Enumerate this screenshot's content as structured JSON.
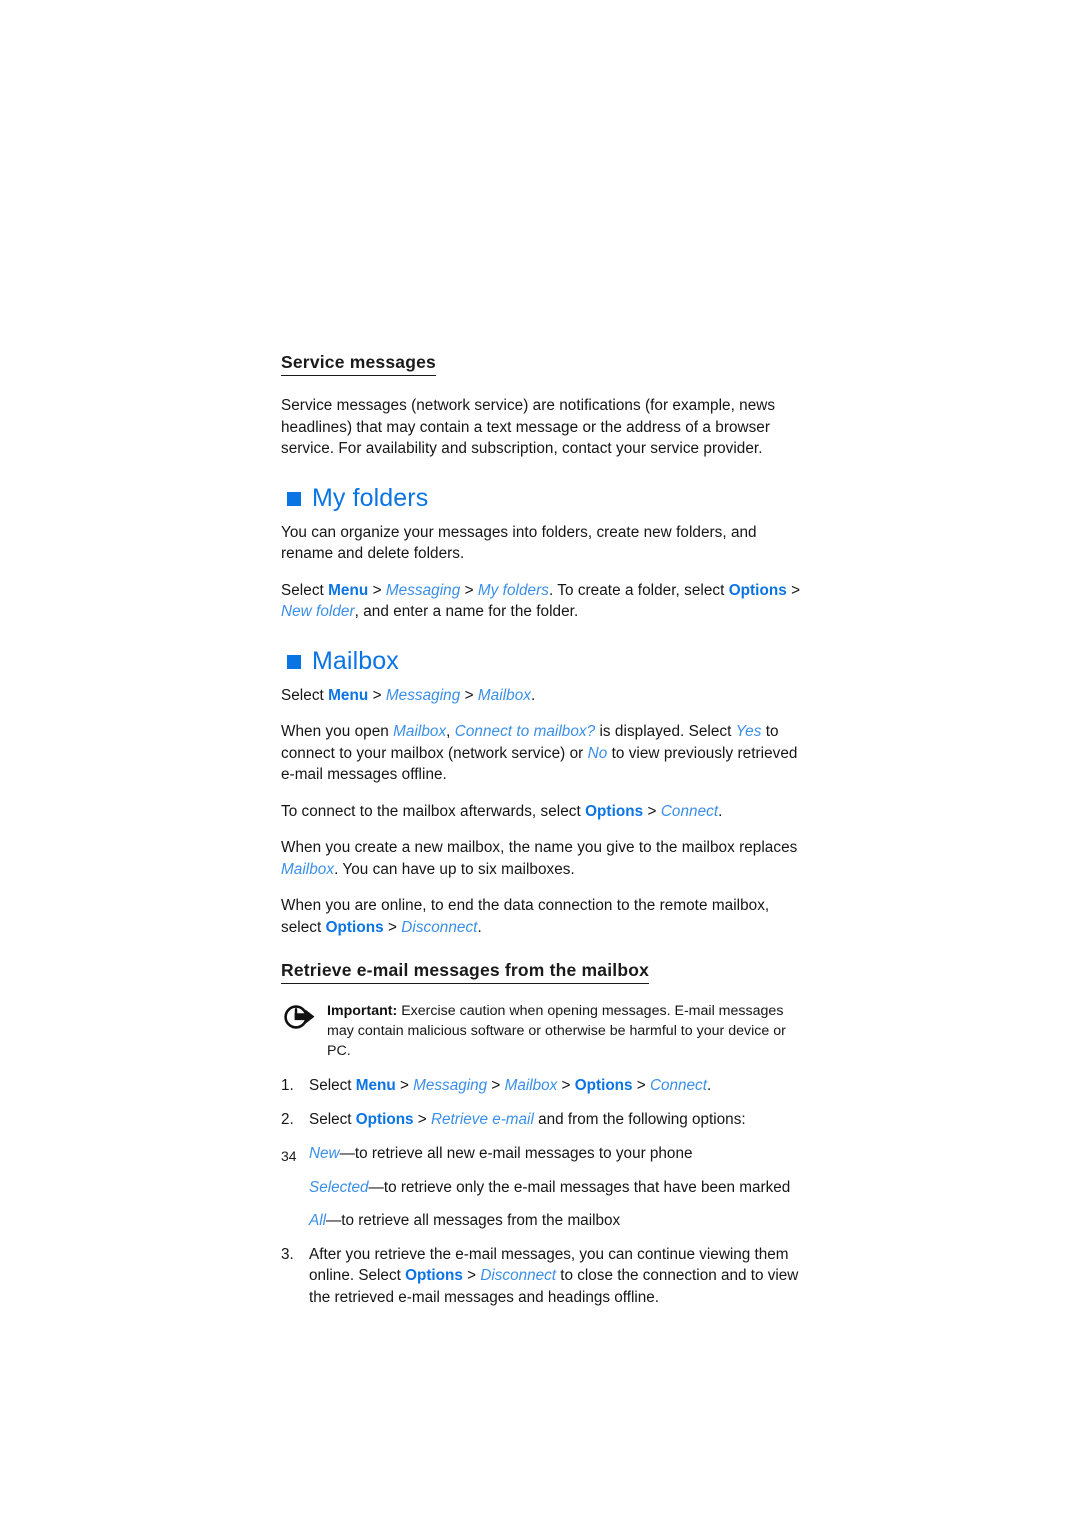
{
  "page": {
    "number": "34",
    "accent_color": "#0b74e5",
    "accent_italic_color": "#3a8fe8",
    "background": "#ffffff"
  },
  "service_messages": {
    "heading": "Service messages",
    "paragraph": "Service messages (network service) are notifications (for example, news headlines) that may contain a text message or the address of a browser service. For availability and subscription, contact your service provider."
  },
  "my_folders": {
    "heading": "My folders",
    "bullet_icon": "filled-square-icon",
    "paragraph_1": "You can organize your messages into folders, create new folders, and rename and delete folders.",
    "path": {
      "select": "Select ",
      "menu": "Menu",
      "sep": " > ",
      "messaging": "Messaging",
      "my_folders": "My folders",
      "tail_1": ". To create a folder, select ",
      "options": "Options",
      "new_folder": "New folder",
      "tail_2": ", and enter a name for the folder."
    }
  },
  "mailbox": {
    "heading": "Mailbox",
    "bullet_icon": "filled-square-icon",
    "path": {
      "select": "Select ",
      "menu": "Menu",
      "sep": " > ",
      "messaging": "Messaging",
      "mailbox": "Mailbox",
      "period": "."
    },
    "open_paragraph": {
      "t1": "When you open ",
      "mailbox": "Mailbox",
      "t2": ", ",
      "connect_q": "Connect to mailbox?",
      "t3": " is displayed. Select ",
      "yes": "Yes",
      "t4": " to connect to your mailbox (network service) or ",
      "no": "No",
      "t5": " to view previously retrieved e-mail messages offline."
    },
    "connect_paragraph": {
      "t1": "To connect to the mailbox afterwards, select ",
      "options": "Options",
      "sep": " > ",
      "connect": "Connect",
      "t2": "."
    },
    "new_mailbox_paragraph": {
      "t1": "When you create a new mailbox, the name you give to the mailbox replaces ",
      "mailbox": "Mailbox",
      "t2": ". You can have up to six mailboxes."
    },
    "disconnect_paragraph": {
      "t1": "When you are online, to end the data connection to the remote mailbox, select ",
      "options": "Options",
      "sep": " > ",
      "disconnect": "Disconnect",
      "t2": "."
    }
  },
  "retrieve": {
    "heading": "Retrieve e-mail messages from the mailbox",
    "note": {
      "icon": "circle-arrow-important-icon",
      "label": "Important:",
      "text": " Exercise caution when opening messages. E-mail messages may contain malicious software or otherwise be harmful to your device or PC."
    },
    "steps": [
      {
        "num": "1.",
        "parts": {
          "t1": "Select ",
          "menu": "Menu",
          "s1": " > ",
          "messaging": "Messaging",
          "s2": " > ",
          "mailbox": "Mailbox",
          "s3": " > ",
          "options": "Options",
          "s4": " > ",
          "connect": "Connect",
          "t2": "."
        }
      },
      {
        "num": "2.",
        "parts": {
          "t1": "Select ",
          "options": "Options",
          "s1": " > ",
          "retrieve_email": "Retrieve e-mail",
          "t2": " and from the following options:"
        }
      },
      {
        "num": "3.",
        "parts": {
          "t1": "After you retrieve the e-mail messages, you can continue viewing them online. Select ",
          "options": "Options",
          "s1": " > ",
          "disconnect": "Disconnect",
          "t2": " to close the connection and to view the retrieved e-mail messages and headings offline."
        }
      }
    ],
    "options": [
      {
        "term": "New",
        "desc": "—to retrieve all new e-mail messages to your phone"
      },
      {
        "term": "Selected",
        "desc": "—to retrieve only the e-mail messages that have been marked"
      },
      {
        "term": "All",
        "desc": "—to retrieve all messages from the mailbox"
      }
    ]
  }
}
